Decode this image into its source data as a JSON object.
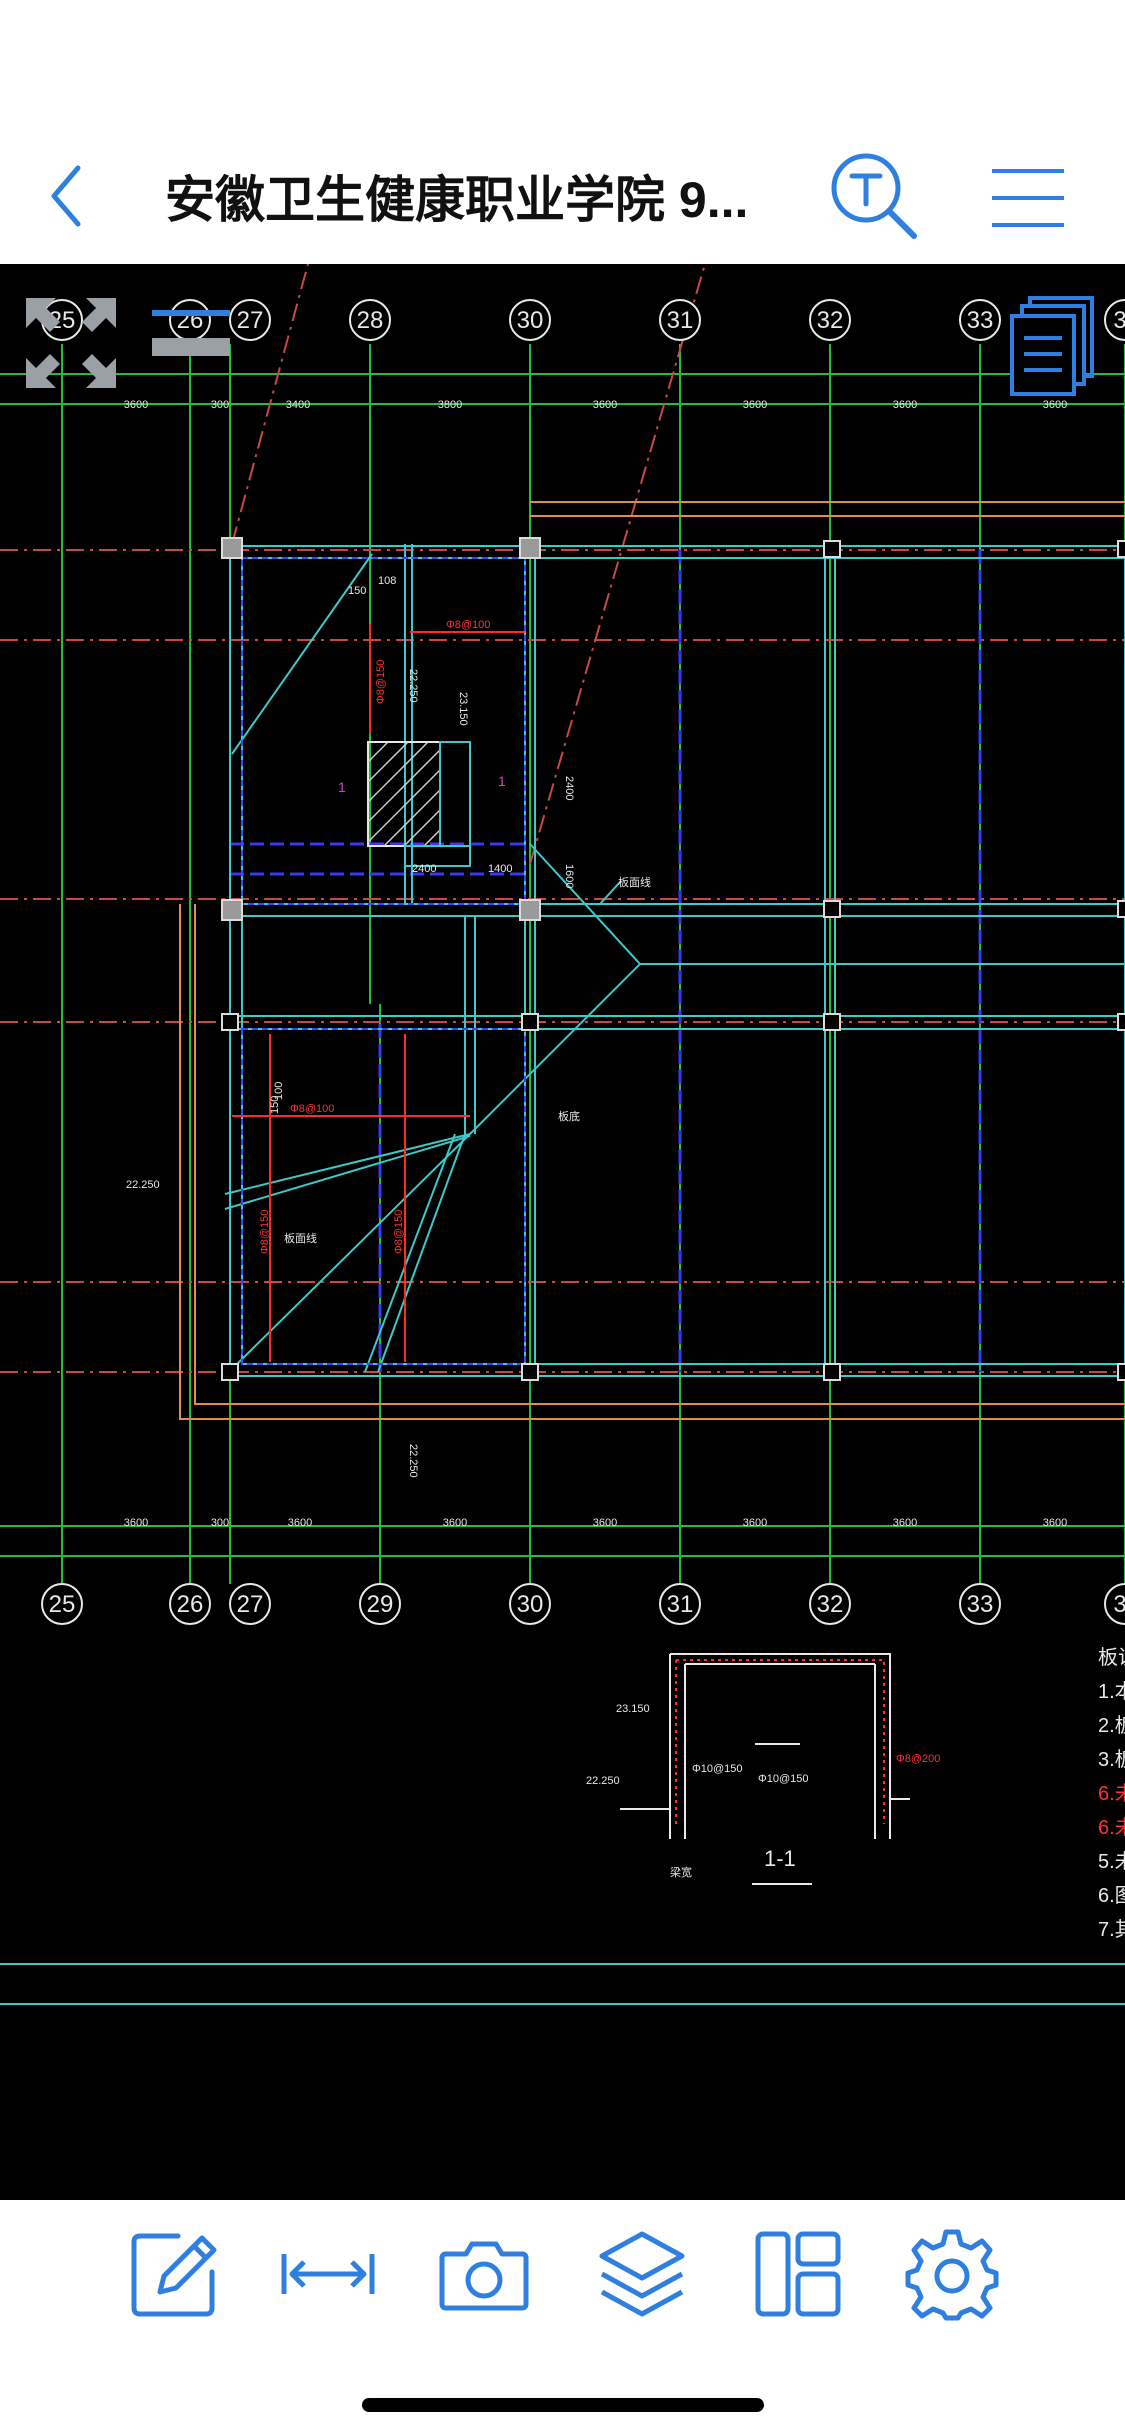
{
  "header": {
    "title": "安徽卫生健康职业学院 9...",
    "back_icon": "chevron-left-icon",
    "text_search_icon": "text-search-icon",
    "menu_icon": "hamburger-menu-icon"
  },
  "colors": {
    "accent": "#2f7fe0",
    "canvas_bg": "#000000",
    "grid_line": "#22c03a",
    "axis_dashed": "#d05050",
    "wall": "#3ec9c9",
    "rebar": "#ff2a2a",
    "beam_blue": "#3a3af0"
  },
  "drawing": {
    "top_axes": [
      "25",
      "26",
      "27",
      "28",
      "30",
      "31",
      "32",
      "33",
      "3"
    ],
    "bottom_axes": [
      "25",
      "26",
      "27",
      "29",
      "30",
      "31",
      "32",
      "33",
      "3"
    ],
    "top_dims": [
      "3600",
      "300",
      "3400",
      "3800",
      "3600",
      "3600",
      "3600",
      "3600"
    ],
    "bottom_dims": [
      "3600",
      "300",
      "3600",
      "3600",
      "3600",
      "3600",
      "3600",
      "3600"
    ],
    "elev_1": "22.250",
    "elev_2": "22.250",
    "elev_3": "23.150",
    "elev_4": "22.250",
    "elev_5": "23.150",
    "dim_2400": "2400",
    "dim_1400": "1400",
    "dim_2400_v": "2400",
    "dim_1600": "1600",
    "dim_150": "150",
    "dim_108": "108",
    "dim_150b": "150",
    "dim_100": "100",
    "rebar_1": "Φ8@100",
    "rebar_2": "Φ8@150",
    "rebar_3": "Φ8@100",
    "rebar_4": "Φ8@150",
    "rebar_5": "Φ8@150",
    "section_mark_a": "1",
    "section_mark_b": "1",
    "leader_1": "板面线",
    "leader_2": "板面线",
    "leader_3": "板底",
    "section_title": "1-1",
    "sec_rebar_1": "Φ10@150",
    "sec_rebar_2": "Φ10@150",
    "sec_rebar_3": "Φ8@200",
    "sec_label": "梁宽",
    "notes": [
      "板说",
      "1.本",
      "2.板",
      "3.板",
      "6.未",
      "6.未",
      "5.未",
      "6.图",
      "7.其"
    ]
  },
  "overlay": {
    "fullscreen_icon": "fullscreen-arrows-icon",
    "linewidth_icon": "line-width-icon",
    "layout_icon": "document-stack-icon"
  },
  "toolbar": {
    "items": [
      "edit-icon",
      "measure-icon",
      "camera-icon",
      "layers-icon",
      "layout-icon",
      "settings-icon"
    ]
  }
}
